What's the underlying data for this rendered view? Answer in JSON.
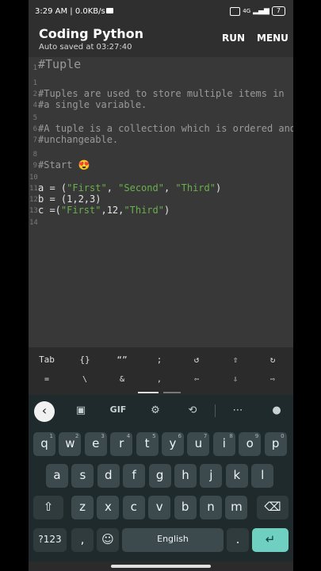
{
  "status": {
    "time_speed": "3:29 AM | 0.0KB/s",
    "signal_label": "4G",
    "battery": "7"
  },
  "appbar": {
    "title": "Coding Python",
    "subtitle": "Auto saved at 03:27:40",
    "run": "RUN",
    "menu": "MENU"
  },
  "editor": {
    "lines": [
      {
        "n": "1",
        "text": "#Tuple"
      },
      {
        "n": "1",
        "text": ""
      },
      {
        "n": "2",
        "text": "#Tuples are used to store multiple items in"
      },
      {
        "n": "4",
        "text": "#a single variable."
      },
      {
        "n": "5",
        "text": ""
      },
      {
        "n": "6",
        "text": "#A tuple is a collection which is ordered and"
      },
      {
        "n": "7",
        "text": "#unchangeable."
      },
      {
        "n": "8",
        "text": ""
      },
      {
        "n": "9",
        "text": "#Start 😍"
      },
      {
        "n": "10",
        "text": ""
      },
      {
        "n": "11",
        "pre": "a = (",
        "s1": "\"First\"",
        "m1": ", ",
        "s2": "\"Second\"",
        "m2": ", ",
        "s3": "\"Third\"",
        "post": ")"
      },
      {
        "n": "12",
        "text": "b = (1,2,3)"
      },
      {
        "n": "13",
        "pre": "c =(",
        "s1": "\"First\"",
        "m1": ",12,",
        "s2": "\"Third\"",
        "post": ")"
      },
      {
        "n": "14",
        "text": ""
      }
    ]
  },
  "symbols": {
    "row1": [
      "Tab",
      "{}",
      "“”",
      ";",
      "↺",
      "⇧",
      "↻"
    ],
    "row2": [
      "=",
      "\\",
      "&",
      ",",
      "⇦",
      "⇩",
      "⇨"
    ]
  },
  "keyboard": {
    "toolbar": {
      "gif": "GIF"
    },
    "row1": [
      {
        "k": "q",
        "h": "1"
      },
      {
        "k": "w",
        "h": "2"
      },
      {
        "k": "e",
        "h": "3"
      },
      {
        "k": "r",
        "h": "4"
      },
      {
        "k": "t",
        "h": "5"
      },
      {
        "k": "y",
        "h": "6"
      },
      {
        "k": "u",
        "h": "7"
      },
      {
        "k": "i",
        "h": "8"
      },
      {
        "k": "o",
        "h": "9"
      },
      {
        "k": "p",
        "h": "0"
      }
    ],
    "row2": [
      "a",
      "s",
      "d",
      "f",
      "g",
      "h",
      "j",
      "k",
      "l"
    ],
    "row3": [
      "z",
      "x",
      "c",
      "v",
      "b",
      "n",
      "m"
    ],
    "sym_key": "?123",
    "comma": ",",
    "space": "English",
    "period": ".",
    "enter_glyph": "↵",
    "shift_glyph": "⇧",
    "backspace_glyph": "⌫",
    "emoji_glyph": "☺"
  }
}
